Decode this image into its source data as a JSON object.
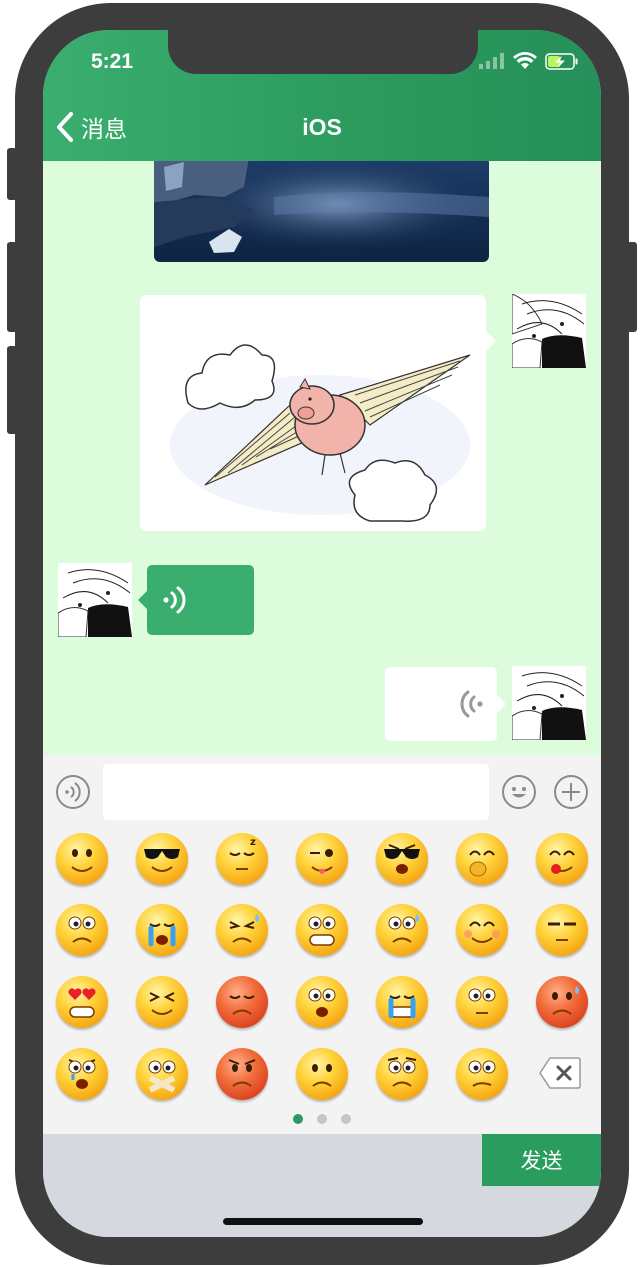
{
  "status_bar": {
    "time": "5:21"
  },
  "nav": {
    "back_label": "消息",
    "title": "iOS"
  },
  "chat": {
    "messages": [
      {
        "from": "other",
        "kind": "image",
        "content": "night lake landscape photo"
      },
      {
        "from": "self",
        "kind": "image",
        "content": "flying pig sketch"
      },
      {
        "from": "other",
        "kind": "voice"
      },
      {
        "from": "self",
        "kind": "voice"
      }
    ]
  },
  "input_bar": {
    "text_value": "",
    "placeholder": ""
  },
  "emoji_panel": {
    "emojis": [
      "smile",
      "cool-sunglasses",
      "sleepy",
      "wink-tongue",
      "shades-angry",
      "shy-cover",
      "laugh-drool",
      "awkward",
      "crying",
      "tired",
      "grin",
      "nervous-sweat",
      "blush",
      "sly",
      "heart-eyes",
      "squint",
      "red-frown",
      "surprised",
      "laugh-tears",
      "bored",
      "red-sweat",
      "angry-tears",
      "mouth-taped",
      "red-angry",
      "sad",
      "worried",
      "confused",
      "delete-key"
    ],
    "page_indicator": {
      "count": 3,
      "active": 0
    }
  },
  "toolbar": {
    "send_label": "发送"
  },
  "colors": {
    "primary": "#2a9c5d",
    "chat_bg": "#dcfcdb",
    "panel_bg": "#f3f3f3"
  }
}
